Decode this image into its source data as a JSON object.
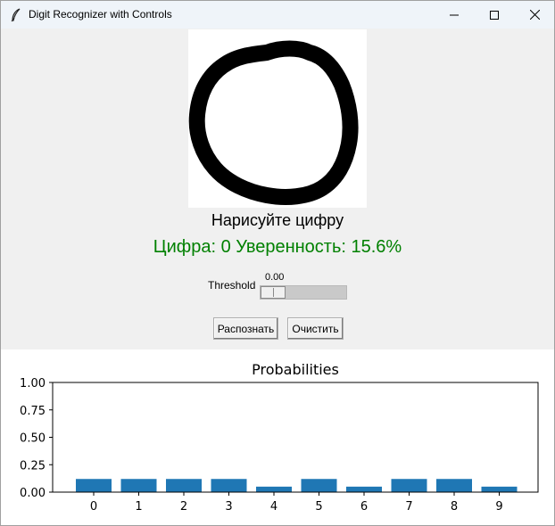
{
  "window": {
    "title": "Digit Recognizer with Controls",
    "icon": "feather-icon"
  },
  "canvas": {
    "background": "#ffffff",
    "stroke_color": "#000000"
  },
  "prompt_text": "Нарисуйте цифру",
  "result_text": "Цифра: 0 Уверенность: 15.6%",
  "result_color": "#008000",
  "threshold": {
    "label": "Threshold",
    "value_text": "0.00",
    "value": 0.0
  },
  "buttons": {
    "recognize_label": "Распознать",
    "clear_label": "Очистить"
  },
  "chart_data": {
    "type": "bar",
    "title": "Probabilities",
    "xlabel": "",
    "ylabel": "",
    "categories": [
      "0",
      "1",
      "2",
      "3",
      "4",
      "5",
      "6",
      "7",
      "8",
      "9"
    ],
    "values": [
      0.12,
      0.12,
      0.12,
      0.12,
      0.05,
      0.12,
      0.05,
      0.12,
      0.12,
      0.05
    ],
    "ylim": [
      0,
      1.0
    ],
    "yticks": [
      "0.00",
      "0.25",
      "0.50",
      "0.75",
      "1.00"
    ],
    "bar_color": "#1f77b4",
    "grid": false,
    "legend": "none"
  }
}
